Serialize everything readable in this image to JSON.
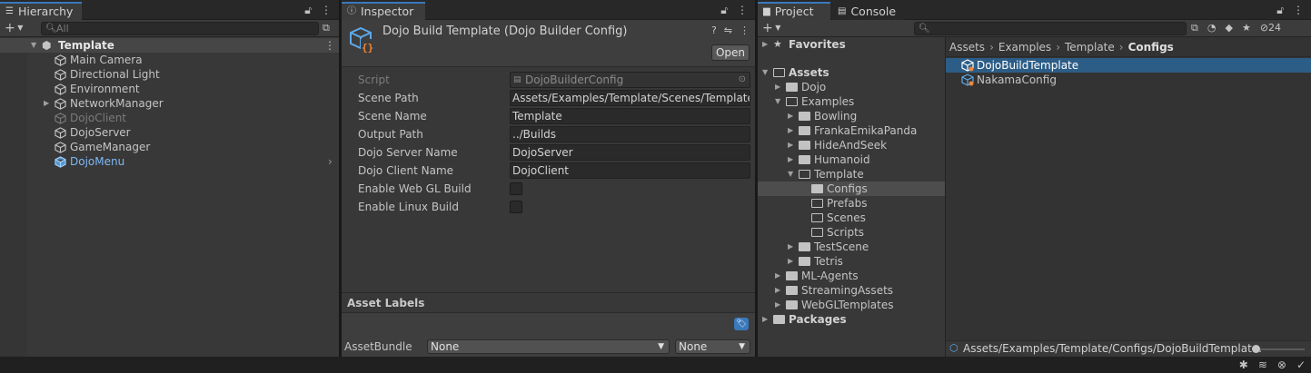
{
  "hierarchy": {
    "tab_label": "Hierarchy",
    "search_placeholder": "All",
    "add_label": "+",
    "scene_name": "Template",
    "objects": [
      {
        "name": "Main Camera",
        "state": "normal"
      },
      {
        "name": "Directional Light",
        "state": "normal"
      },
      {
        "name": "Environment",
        "state": "normal"
      },
      {
        "name": "NetworkManager",
        "state": "normal"
      },
      {
        "name": "DojoClient",
        "state": "disabled"
      },
      {
        "name": "DojoServer",
        "state": "normal"
      },
      {
        "name": "GameManager",
        "state": "normal"
      },
      {
        "name": "DojoMenu",
        "state": "prefab"
      }
    ]
  },
  "inspector": {
    "tab_label": "Inspector",
    "title": "Dojo Build Template (Dojo Builder Config)",
    "open_button": "Open",
    "script_label": "Script",
    "script_value": "DojoBuilderConfig",
    "fields": [
      {
        "label": "Scene Path",
        "value": "Assets/Examples/Template/Scenes/Template.u"
      },
      {
        "label": "Scene Name",
        "value": "Template"
      },
      {
        "label": "Output Path",
        "value": "../Builds"
      },
      {
        "label": "Dojo Server Name",
        "value": "DojoServer"
      },
      {
        "label": "Dojo Client Name",
        "value": "DojoClient"
      }
    ],
    "checkboxes": [
      {
        "label": "Enable Web GL Build",
        "checked": false
      },
      {
        "label": "Enable Linux Build",
        "checked": false
      }
    ],
    "asset_labels_title": "Asset Labels",
    "assetbundle_label": "AssetBundle",
    "assetbundle_value": "None",
    "variant_value": "None"
  },
  "project": {
    "tab_label": "Project",
    "console_tab_label": "Console",
    "hidden_count": "24",
    "favorites_label": "Favorites",
    "tree": [
      {
        "name": "Assets",
        "depth": 0,
        "bold": true,
        "arrow": "down",
        "folder": "open"
      },
      {
        "name": "Dojo",
        "depth": 1,
        "arrow": "right",
        "folder": "filled"
      },
      {
        "name": "Examples",
        "depth": 1,
        "arrow": "down",
        "folder": "open"
      },
      {
        "name": "Bowling",
        "depth": 2,
        "arrow": "right",
        "folder": "filled"
      },
      {
        "name": "FrankaEmikaPanda",
        "depth": 2,
        "arrow": "right",
        "folder": "filled"
      },
      {
        "name": "HideAndSeek",
        "depth": 2,
        "arrow": "right",
        "folder": "filled"
      },
      {
        "name": "Humanoid",
        "depth": 2,
        "arrow": "right",
        "folder": "filled"
      },
      {
        "name": "Template",
        "depth": 2,
        "arrow": "down",
        "folder": "open"
      },
      {
        "name": "Configs",
        "depth": 3,
        "arrow": "",
        "folder": "filled",
        "selected": true
      },
      {
        "name": "Prefabs",
        "depth": 3,
        "arrow": "",
        "folder": "empty"
      },
      {
        "name": "Scenes",
        "depth": 3,
        "arrow": "",
        "folder": "empty"
      },
      {
        "name": "Scripts",
        "depth": 3,
        "arrow": "",
        "folder": "empty"
      },
      {
        "name": "TestScene",
        "depth": 2,
        "arrow": "right",
        "folder": "filled"
      },
      {
        "name": "Tetris",
        "depth": 2,
        "arrow": "right",
        "folder": "filled"
      },
      {
        "name": "ML-Agents",
        "depth": 1,
        "arrow": "right",
        "folder": "filled"
      },
      {
        "name": "StreamingAssets",
        "depth": 1,
        "arrow": "right",
        "folder": "filled"
      },
      {
        "name": "WebGLTemplates",
        "depth": 1,
        "arrow": "right",
        "folder": "filled"
      },
      {
        "name": "Packages",
        "depth": 0,
        "bold": true,
        "arrow": "right",
        "folder": "filled"
      }
    ],
    "breadcrumb": [
      "Assets",
      "Examples",
      "Template",
      "Configs"
    ],
    "assets": [
      {
        "name": "DojoBuildTemplate",
        "selected": true
      },
      {
        "name": "NakamaConfig",
        "selected": false
      }
    ],
    "footer_path": "Assets/Examples/Template/Configs/DojoBuildTemplate."
  },
  "colors": {
    "accent": "#2c5d87",
    "prefab": "#7eb8f5",
    "tab_highlight": "#3a79bb"
  }
}
